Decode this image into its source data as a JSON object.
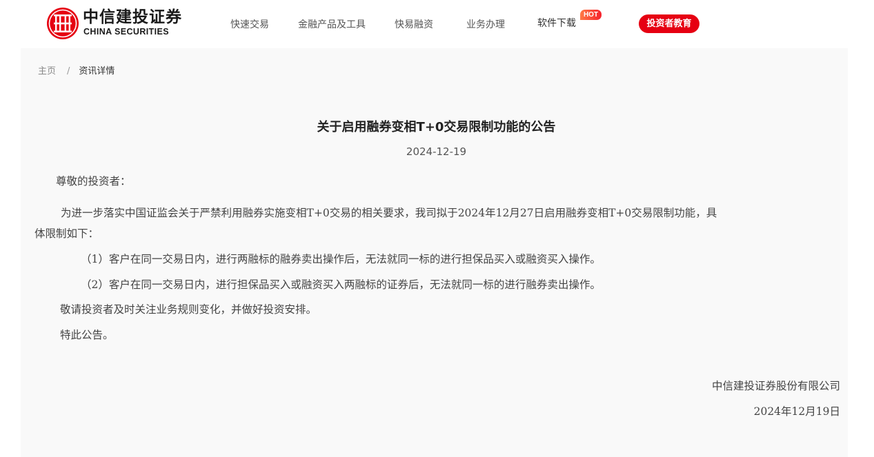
{
  "header": {
    "logo_cn": "中信建投证券",
    "logo_en": "CHINA SECURITIES",
    "nav": [
      {
        "label": "快速交易"
      },
      {
        "label": "金融产品及工具"
      },
      {
        "label": "快易融资"
      },
      {
        "label": "业务办理"
      },
      {
        "label": "软件下载",
        "badge": "HOT"
      }
    ],
    "edu_button": "投资者教育"
  },
  "breadcrumb": {
    "home": "主页",
    "separator": "/",
    "current": "资讯详情"
  },
  "article": {
    "title": "关于启用融券变相T+0交易限制功能的公告",
    "date": "2024-12-19",
    "greeting": "尊敬的投资者：",
    "para1_line1": "为进一步落实中国证监会关于严禁利用融券实施变相T+0交易的相关要求，我司拟于2024年12月27日启用融券变相T+0交易限制功能，具",
    "para1_line2": "体限制如下：",
    "item1": "（1）客户在同一交易日内，进行两融标的融券卖出操作后，无法就同一标的进行担保品买入或融资买入操作。",
    "item2": "（2）客户在同一交易日内，进行担保品买入或融资买入两融标的证券后，无法就同一标的进行融券卖出操作。",
    "notice": "敬请投资者及时关注业务规则变化，并做好投资安排。",
    "closing": "特此公告。",
    "signature": "中信建投证券股份有限公司",
    "sign_date": "2024年12月19日"
  },
  "colors": {
    "brand_red": "#e60012",
    "content_bg": "#f9f9f9"
  }
}
